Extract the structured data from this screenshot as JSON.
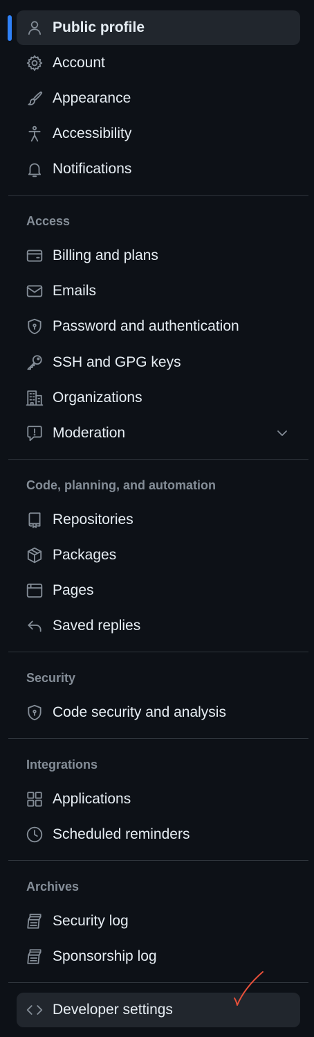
{
  "colors": {
    "background": "#0d1117",
    "active_background": "#21262d",
    "accent": "#2f81f7",
    "text": "#e6edf3",
    "muted": "#848d97",
    "divider": "#30363d",
    "annotation": "#e8503a"
  },
  "sections": [
    {
      "items": [
        {
          "label": "Public profile",
          "icon": "person-icon",
          "active": true
        },
        {
          "label": "Account",
          "icon": "gear-icon"
        },
        {
          "label": "Appearance",
          "icon": "paintbrush-icon"
        },
        {
          "label": "Accessibility",
          "icon": "accessibility-icon"
        },
        {
          "label": "Notifications",
          "icon": "bell-icon"
        }
      ]
    },
    {
      "heading": "Access",
      "items": [
        {
          "label": "Billing and plans",
          "icon": "credit-card-icon"
        },
        {
          "label": "Emails",
          "icon": "mail-icon"
        },
        {
          "label": "Password and authentication",
          "icon": "shield-lock-icon"
        },
        {
          "label": "SSH and GPG keys",
          "icon": "key-icon"
        },
        {
          "label": "Organizations",
          "icon": "organization-icon"
        },
        {
          "label": "Moderation",
          "icon": "report-icon",
          "expandable": true
        }
      ]
    },
    {
      "heading": "Code, planning, and automation",
      "items": [
        {
          "label": "Repositories",
          "icon": "repo-icon"
        },
        {
          "label": "Packages",
          "icon": "package-icon"
        },
        {
          "label": "Pages",
          "icon": "browser-icon"
        },
        {
          "label": "Saved replies",
          "icon": "reply-icon"
        }
      ]
    },
    {
      "heading": "Security",
      "items": [
        {
          "label": "Code security and analysis",
          "icon": "shield-lock-icon"
        }
      ]
    },
    {
      "heading": "Integrations",
      "items": [
        {
          "label": "Applications",
          "icon": "apps-icon"
        },
        {
          "label": "Scheduled reminders",
          "icon": "clock-icon"
        }
      ]
    },
    {
      "heading": "Archives",
      "items": [
        {
          "label": "Security log",
          "icon": "log-icon"
        },
        {
          "label": "Sponsorship log",
          "icon": "log-icon"
        }
      ]
    },
    {
      "items": [
        {
          "label": "Developer settings",
          "icon": "code-icon",
          "highlighted": true
        }
      ]
    }
  ]
}
